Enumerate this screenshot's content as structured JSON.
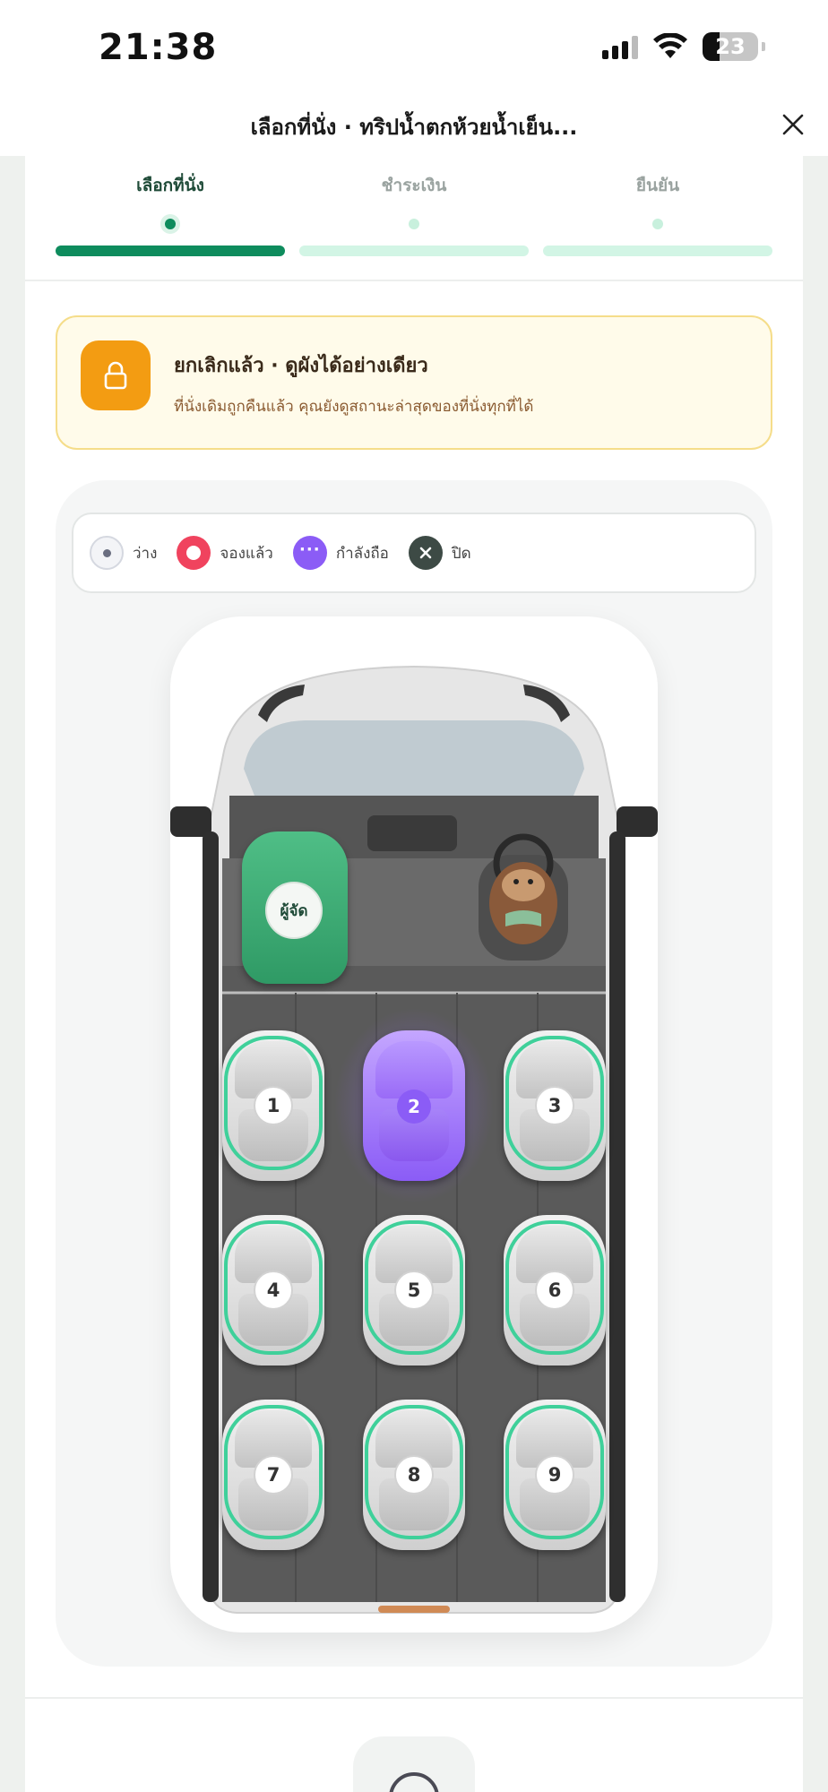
{
  "status_bar": {
    "time": "21:38",
    "battery": "23"
  },
  "header": {
    "title": "เลือกที่นั่ง · ทริปน้ำตกห้วยน้ำเย็น..."
  },
  "stepper": {
    "steps": [
      {
        "label": "เลือกที่นั่ง",
        "active": true
      },
      {
        "label": "ชำระเงิน",
        "active": false
      },
      {
        "label": "ยืนยัน",
        "active": false
      }
    ]
  },
  "notice": {
    "title": "ยกเลิกแล้ว · ดูผังได้อย่างเดียว",
    "text": "ที่นั่งเดิมถูกคืนแล้ว คุณยังดูสถานะล่าสุดของที่นั่งทุกที่ได้",
    "icon": "lock-icon",
    "color": "#f39c12"
  },
  "legend": [
    {
      "label": "ว่าง",
      "icon": "available-dot-icon",
      "color": "#e9ebf1"
    },
    {
      "label": "จองแล้ว",
      "icon": "booked-ring-icon",
      "color": "#f0435e"
    },
    {
      "label": "กำลังถือ",
      "icon": "holding-dots-icon",
      "color": "#8b5cf6"
    },
    {
      "label": "ปิด",
      "icon": "closed-x-icon",
      "color": "#3d4a45"
    }
  ],
  "seat_map": {
    "organizer_label": "ผู้จัด",
    "seats": [
      {
        "number": "1",
        "status": "available"
      },
      {
        "number": "2",
        "status": "holding"
      },
      {
        "number": "3",
        "status": "available"
      },
      {
        "number": "4",
        "status": "available"
      },
      {
        "number": "5",
        "status": "available"
      },
      {
        "number": "6",
        "status": "available"
      },
      {
        "number": "7",
        "status": "available"
      },
      {
        "number": "8",
        "status": "available"
      },
      {
        "number": "9",
        "status": "available"
      }
    ]
  },
  "colors": {
    "brand_green": "#0e8c5d",
    "available_ring": "#3fd09a",
    "holding": "#8b5cf6",
    "organizer": "#3aa872"
  }
}
